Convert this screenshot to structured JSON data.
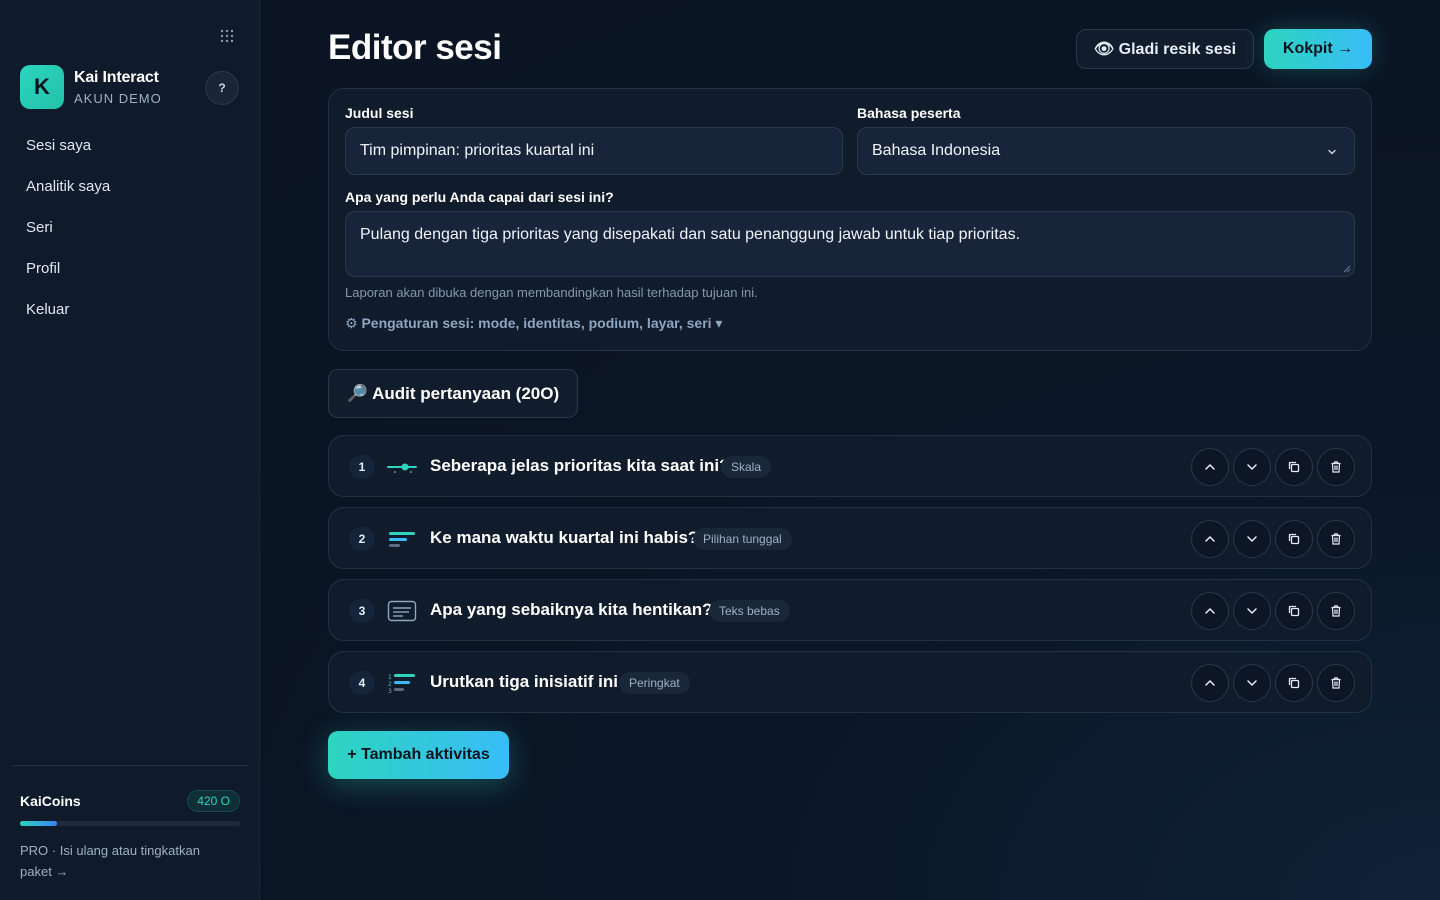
{
  "sidebar": {
    "brand_initial": "K",
    "brand_name": "Kai Interact",
    "brand_sub": "AKUN DEMO",
    "help_label": "?",
    "nav": [
      "Sesi saya",
      "Analitik saya",
      "Seri",
      "Profil",
      "Keluar"
    ],
    "coins_label": "KaiCoins",
    "coins_badge": "420 O",
    "coins_progress": 0.17,
    "coins_text": "PRO · Isi ulang atau tingkatkan paket →"
  },
  "header": {
    "title": "Editor sesi",
    "rehearsal_label": "👁 Gladi resik sesi",
    "cockpit_label": "Kokpit →"
  },
  "form": {
    "title_label": "Judul sesi",
    "title_value": "Tim pimpinan: prioritas kuartal ini",
    "language_label": "Bahasa peserta",
    "language_value": "Bahasa Indonesia",
    "goal_label": "Apa yang perlu Anda capai dari sesi ini?",
    "goal_value": "Pulang dengan tiga prioritas yang disepakati dan satu penanggung jawab untuk tiap prioritas.",
    "goal_hint": "Laporan akan dibuka dengan membandingkan hasil terhadap tujuan ini.",
    "settings_label": "⚙ Pengaturan sesi: mode, identitas, podium, layar, seri ▾"
  },
  "audit_label": "🔎 Audit pertanyaan (20O)",
  "questions": [
    {
      "num": "1",
      "text": "Seberapa jelas prioritas kita saat ini?",
      "tag": "Skala",
      "icon": "slider-icon"
    },
    {
      "num": "2",
      "text": "Ke mana waktu kuartal ini habis?",
      "tag": "Pilihan tunggal",
      "icon": "bars-icon"
    },
    {
      "num": "3",
      "text": "Apa yang sebaiknya kita hentikan?",
      "tag": "Teks bebas",
      "icon": "text-box-icon"
    },
    {
      "num": "4",
      "text": "Urutkan tiga inisiatif ini",
      "tag": "Peringkat",
      "icon": "ranking-icon"
    }
  ],
  "add_label": "+ Tambah aktivitas",
  "colors": {
    "accent": "#2dd4bf",
    "accent2": "#38bdf8",
    "background": "#0a1422"
  }
}
